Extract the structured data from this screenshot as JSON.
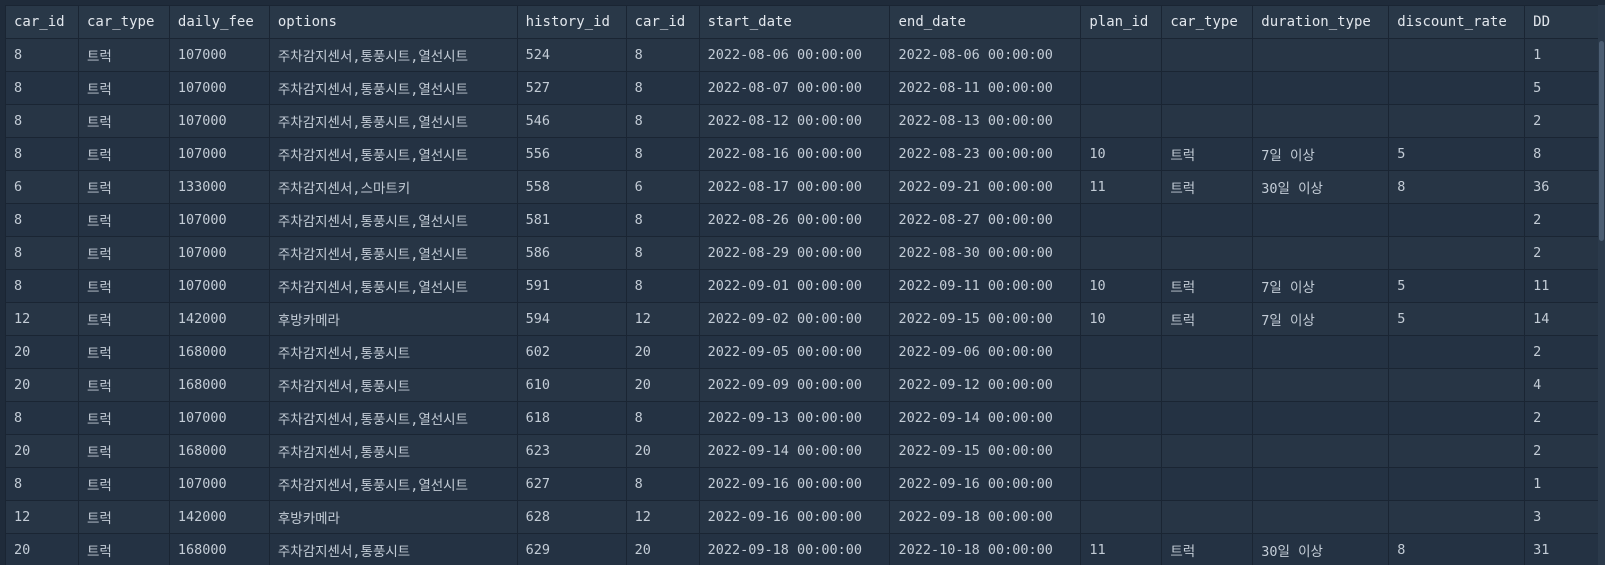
{
  "columns": [
    "car_id",
    "car_type",
    "daily_fee",
    "options",
    "history_id",
    "car_id",
    "start_date",
    "end_date",
    "plan_id",
    "car_type",
    "duration_type",
    "discount_rate",
    "DD"
  ],
  "rows": [
    [
      "8",
      "트럭",
      "107000",
      "주차감지센서,통풍시트,열선시트",
      "524",
      "8",
      "2022-08-06 00:00:00",
      "2022-08-06 00:00:00",
      "",
      "",
      "",
      "",
      "1"
    ],
    [
      "8",
      "트럭",
      "107000",
      "주차감지센서,통풍시트,열선시트",
      "527",
      "8",
      "2022-08-07 00:00:00",
      "2022-08-11 00:00:00",
      "",
      "",
      "",
      "",
      "5"
    ],
    [
      "8",
      "트럭",
      "107000",
      "주차감지센서,통풍시트,열선시트",
      "546",
      "8",
      "2022-08-12 00:00:00",
      "2022-08-13 00:00:00",
      "",
      "",
      "",
      "",
      "2"
    ],
    [
      "8",
      "트럭",
      "107000",
      "주차감지센서,통풍시트,열선시트",
      "556",
      "8",
      "2022-08-16 00:00:00",
      "2022-08-23 00:00:00",
      "10",
      "트럭",
      "7일 이상",
      "5",
      "8"
    ],
    [
      "6",
      "트럭",
      "133000",
      "주차감지센서,스마트키",
      "558",
      "6",
      "2022-08-17 00:00:00",
      "2022-09-21 00:00:00",
      "11",
      "트럭",
      "30일 이상",
      "8",
      "36"
    ],
    [
      "8",
      "트럭",
      "107000",
      "주차감지센서,통풍시트,열선시트",
      "581",
      "8",
      "2022-08-26 00:00:00",
      "2022-08-27 00:00:00",
      "",
      "",
      "",
      "",
      "2"
    ],
    [
      "8",
      "트럭",
      "107000",
      "주차감지센서,통풍시트,열선시트",
      "586",
      "8",
      "2022-08-29 00:00:00",
      "2022-08-30 00:00:00",
      "",
      "",
      "",
      "",
      "2"
    ],
    [
      "8",
      "트럭",
      "107000",
      "주차감지센서,통풍시트,열선시트",
      "591",
      "8",
      "2022-09-01 00:00:00",
      "2022-09-11 00:00:00",
      "10",
      "트럭",
      "7일 이상",
      "5",
      "11"
    ],
    [
      "12",
      "트럭",
      "142000",
      "후방카메라",
      "594",
      "12",
      "2022-09-02 00:00:00",
      "2022-09-15 00:00:00",
      "10",
      "트럭",
      "7일 이상",
      "5",
      "14"
    ],
    [
      "20",
      "트럭",
      "168000",
      "주차감지센서,통풍시트",
      "602",
      "20",
      "2022-09-05 00:00:00",
      "2022-09-06 00:00:00",
      "",
      "",
      "",
      "",
      "2"
    ],
    [
      "20",
      "트럭",
      "168000",
      "주차감지센서,통풍시트",
      "610",
      "20",
      "2022-09-09 00:00:00",
      "2022-09-12 00:00:00",
      "",
      "",
      "",
      "",
      "4"
    ],
    [
      "8",
      "트럭",
      "107000",
      "주차감지센서,통풍시트,열선시트",
      "618",
      "8",
      "2022-09-13 00:00:00",
      "2022-09-14 00:00:00",
      "",
      "",
      "",
      "",
      "2"
    ],
    [
      "20",
      "트럭",
      "168000",
      "주차감지센서,통풍시트",
      "623",
      "20",
      "2022-09-14 00:00:00",
      "2022-09-15 00:00:00",
      "",
      "",
      "",
      "",
      "2"
    ],
    [
      "8",
      "트럭",
      "107000",
      "주차감지센서,통풍시트,열선시트",
      "627",
      "8",
      "2022-09-16 00:00:00",
      "2022-09-16 00:00:00",
      "",
      "",
      "",
      "",
      "1"
    ],
    [
      "12",
      "트럭",
      "142000",
      "후방카메라",
      "628",
      "12",
      "2022-09-16 00:00:00",
      "2022-09-18 00:00:00",
      "",
      "",
      "",
      "",
      "3"
    ],
    [
      "20",
      "트럭",
      "168000",
      "주차감지센서,통풍시트",
      "629",
      "20",
      "2022-09-18 00:00:00",
      "2022-10-18 00:00:00",
      "11",
      "트럭",
      "30일 이상",
      "8",
      "31"
    ]
  ]
}
